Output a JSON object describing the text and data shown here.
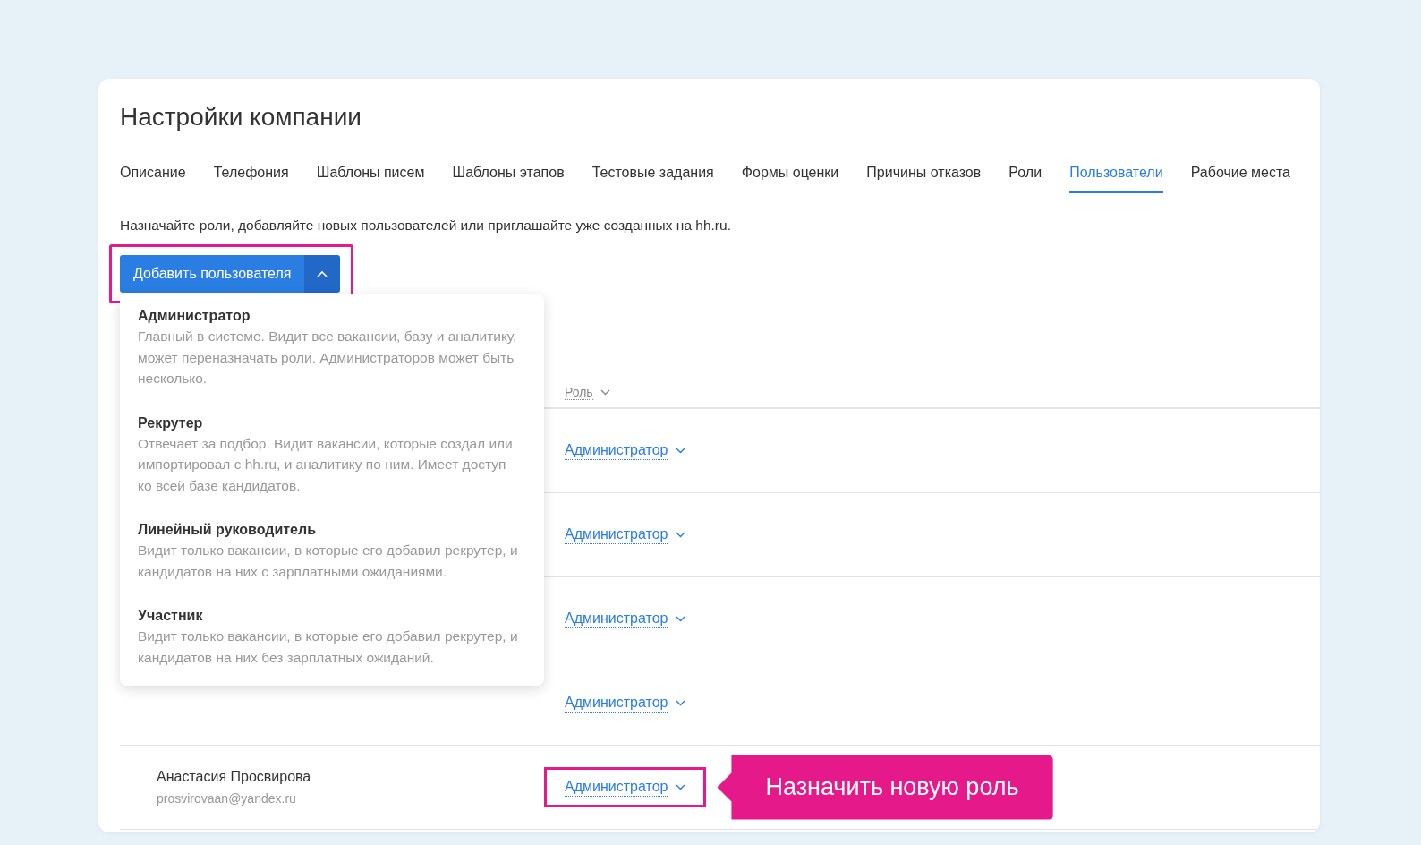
{
  "page": {
    "title": "Настройки компании"
  },
  "tabs": [
    {
      "label": "Описание",
      "selected": false
    },
    {
      "label": "Телефония",
      "selected": false
    },
    {
      "label": "Шаблоны писем",
      "selected": false
    },
    {
      "label": "Шаблоны этапов",
      "selected": false
    },
    {
      "label": "Тестовые задания",
      "selected": false
    },
    {
      "label": "Формы оценки",
      "selected": false
    },
    {
      "label": "Причины отказов",
      "selected": false
    },
    {
      "label": "Роли",
      "selected": false
    },
    {
      "label": "Пользователи",
      "selected": true
    },
    {
      "label": "Рабочие места",
      "selected": false
    }
  ],
  "description": "Назначайте роли, добавляйте новых пользователей или приглашайте уже созданных на hh.ru.",
  "add_button": {
    "label": "Добавить пользователя",
    "menu_open": true,
    "highlighted": true
  },
  "role_menu": [
    {
      "title": "Администратор",
      "description": "Главный в системе. Видит все вакансии, базу и аналитику, может переназначать роли. Администраторов может быть несколько."
    },
    {
      "title": "Рекрутер",
      "description": "Отвечает за подбор. Видит вакансии, которые создал или импортировал с hh.ru, и аналитику по ним. Имеет доступ ко всей базе кандидатов."
    },
    {
      "title": "Линейный руководитель",
      "description": "Видит только вакансии, в которые его добавил рекрутер, и кандидатов на них с зарплатными ожиданиями."
    },
    {
      "title": "Участник",
      "description": "Видит только вакансии, в которые его добавил рекрутер, и кандидатов на них без зарплатных ожиданий."
    }
  ],
  "table": {
    "columns": [
      "Роль"
    ],
    "rows": [
      {
        "role": "Администратор",
        "highlighted": false
      },
      {
        "role": "Администратор",
        "highlighted": false
      },
      {
        "role": "Администратор",
        "highlighted": false
      },
      {
        "role": "Администратор",
        "highlighted": false
      },
      {
        "name": "Анастасия Просвирова",
        "email": "prosvirovaan@yandex.ru",
        "role": "Администратор",
        "highlighted": true
      }
    ]
  },
  "callout": "Назначить новую роль"
}
